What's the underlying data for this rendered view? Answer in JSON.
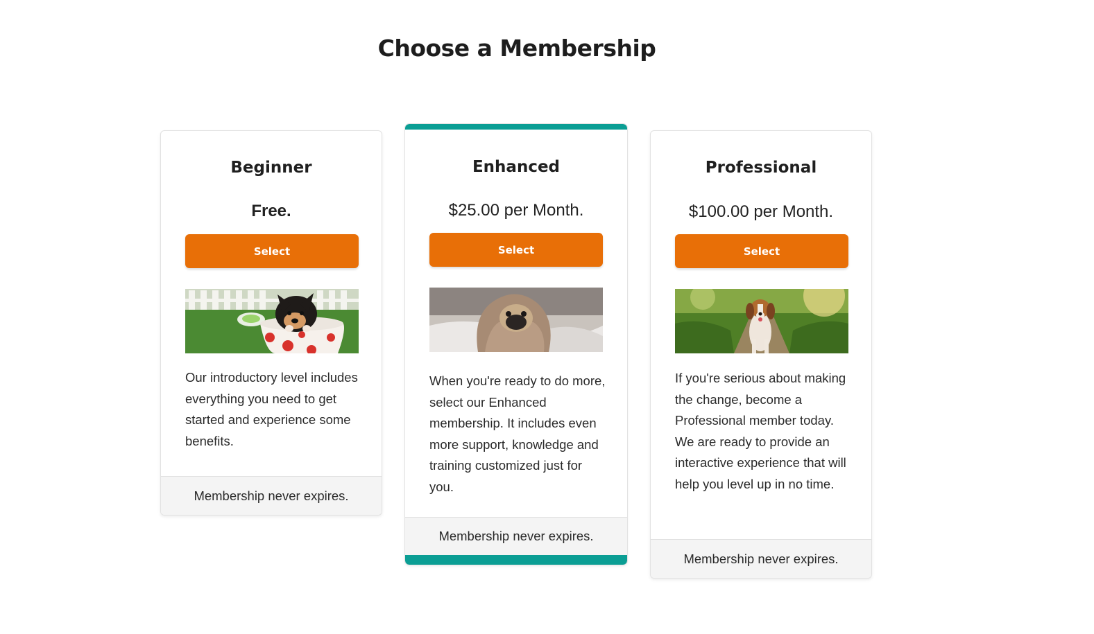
{
  "page": {
    "title": "Choose a Membership"
  },
  "plans": [
    {
      "name": "Beginner",
      "price": "Free.",
      "button_label": "Select",
      "image_icon": "puppy-in-cup-image",
      "description": "Our introductory level includes everything you need to get started and experience some benefits.",
      "footer": "Membership never expires."
    },
    {
      "name": "Enhanced",
      "price": "$25.00 per Month.",
      "button_label": "Select",
      "image_icon": "pug-in-blanket-image",
      "description": "When you're ready to do more, select our Enhanced membership. It includes even more support, knowledge and training customized just for you.",
      "footer": "Membership never expires.",
      "featured": true
    },
    {
      "name": "Professional",
      "price": "$100.00 per Month.",
      "button_label": "Select",
      "image_icon": "beagle-on-trail-image",
      "description": "If you're serious about making the change, become a Professional member today. We are ready to provide an interactive experience that will help you level up in no time.",
      "footer": "Membership never expires."
    }
  ],
  "colors": {
    "accent_orange": "#e86f07",
    "featured_teal": "#0b9e94",
    "footer_bg": "#f4f4f4"
  }
}
